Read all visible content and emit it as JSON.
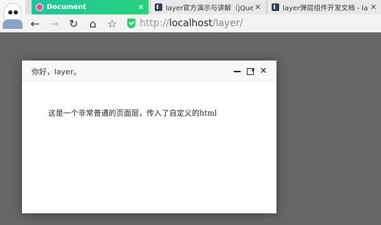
{
  "browser": {
    "tabs": [
      {
        "label": "Document",
        "close": "✕"
      },
      {
        "label": "layer官方演示与讲解（jQuery弹",
        "close": "✕"
      },
      {
        "label": "layer弹层组件开发文档 - layui",
        "close": "✕"
      }
    ],
    "nav": {
      "back": "←",
      "forward": "→",
      "reload": "↻",
      "home": "⌂",
      "bookmark": "☆"
    },
    "address": {
      "protocol": "http://",
      "host": "localhost",
      "path": "/layer/"
    }
  },
  "layer": {
    "title": "你好，layer。",
    "content": "这是一个非常普通的页面层，传入了自定义的html",
    "controls": {
      "close": "✕"
    }
  },
  "colors": {
    "tab_active_start": "#21c2a0",
    "tab_active_end": "#28d37a",
    "backdrop": "#666666"
  }
}
